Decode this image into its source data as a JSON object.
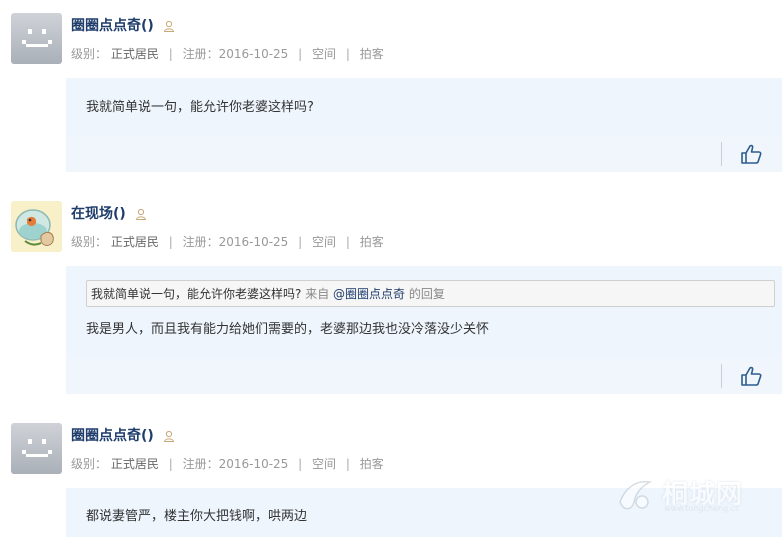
{
  "posts": [
    {
      "username": "圈圈点点奇()",
      "meta": {
        "level_label": "级别：",
        "level": "正式居民",
        "reg_label": "注册：",
        "reg_date": "2016-10-25",
        "space": "空间",
        "pai": "拍客"
      },
      "content": "我就简单说一句，能允许你老婆这样吗?"
    },
    {
      "username": "在现场()",
      "meta": {
        "level_label": "级别：",
        "level": "正式居民",
        "reg_label": "注册：",
        "reg_date": "2016-10-25",
        "space": "空间",
        "pai": "拍客"
      },
      "quote": {
        "text": "我就简单说一句，能允许你老婆这样吗?",
        "from": "来自",
        "author": "@圈圈点点奇",
        "suffix": "的回复"
      },
      "content": "我是男人，而且我有能力给她们需要的，老婆那边我也没冷落没少关怀"
    },
    {
      "username": "圈圈点点奇()",
      "meta": {
        "level_label": "级别：",
        "level": "正式居民",
        "reg_label": "注册：",
        "reg_date": "2016-10-25",
        "space": "空间",
        "pai": "拍客"
      },
      "content": "都说妻管严，楼主你大把钱啊，哄两边"
    }
  ],
  "icons": {
    "like": "thumbs-up-icon",
    "user": "user-icon",
    "avatar_default": "default-avatar-icon"
  },
  "watermark": {
    "text": "桐城网",
    "sub": "www.tongcheng.cc"
  }
}
